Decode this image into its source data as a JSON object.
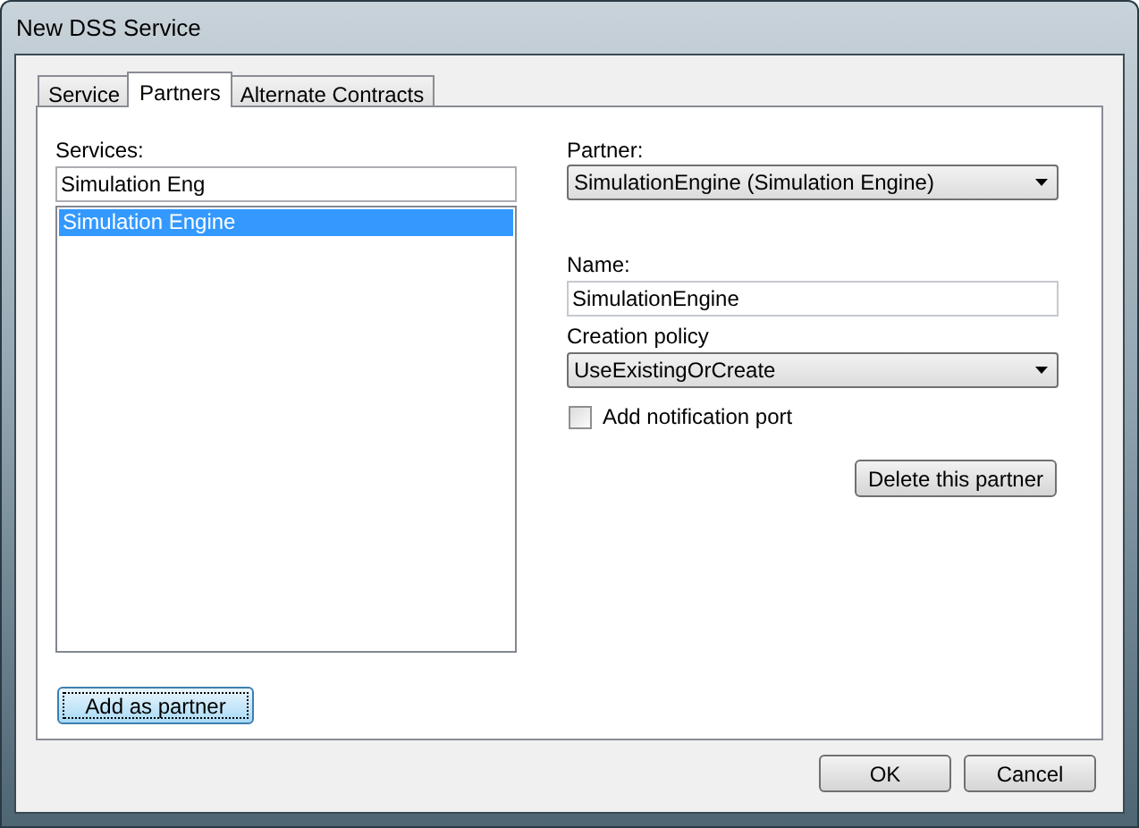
{
  "window": {
    "title": "New DSS Service"
  },
  "tabs": [
    {
      "label": "Service",
      "selected": false
    },
    {
      "label": "Partners",
      "selected": true
    },
    {
      "label": "Alternate Contracts",
      "selected": false
    }
  ],
  "services": {
    "label": "Services:",
    "search_value": "Simulation Eng",
    "items": [
      {
        "label": "Simulation Engine",
        "selected": true
      }
    ]
  },
  "add_button": "Add as partner",
  "partner": {
    "label": "Partner:",
    "value": "SimulationEngine (Simulation Engine)"
  },
  "name": {
    "label": "Name:",
    "value": "SimulationEngine"
  },
  "creation_policy": {
    "label": "Creation policy",
    "value": "UseExistingOrCreate"
  },
  "notification_port": {
    "label": "Add notification port",
    "checked": false
  },
  "delete_button": "Delete this partner",
  "buttons": [
    "OK",
    "Cancel"
  ]
}
